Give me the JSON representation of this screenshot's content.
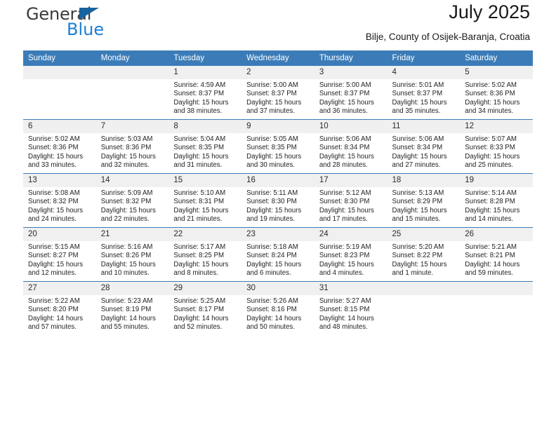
{
  "brand": {
    "name_part1": "General",
    "name_part2": "Blue",
    "triangle_color": "#16639f",
    "blue_color": "#1b7fd4"
  },
  "header": {
    "month_title": "July 2025",
    "location": "Bilje, County of Osijek-Baranja, Croatia"
  },
  "theme": {
    "header_blue": "#3b7cb8",
    "daynum_band": "#f0f0f0",
    "text": "#232323"
  },
  "weekday_headers": [
    "Sunday",
    "Monday",
    "Tuesday",
    "Wednesday",
    "Thursday",
    "Friday",
    "Saturday"
  ],
  "weeks": [
    {
      "days": [
        {
          "num": "",
          "empty": true,
          "sunrise": "",
          "sunset": "",
          "daylight1": "",
          "daylight2": ""
        },
        {
          "num": "",
          "empty": true,
          "sunrise": "",
          "sunset": "",
          "daylight1": "",
          "daylight2": ""
        },
        {
          "num": "1",
          "sunrise": "Sunrise: 4:59 AM",
          "sunset": "Sunset: 8:37 PM",
          "daylight1": "Daylight: 15 hours",
          "daylight2": "and 38 minutes."
        },
        {
          "num": "2",
          "sunrise": "Sunrise: 5:00 AM",
          "sunset": "Sunset: 8:37 PM",
          "daylight1": "Daylight: 15 hours",
          "daylight2": "and 37 minutes."
        },
        {
          "num": "3",
          "sunrise": "Sunrise: 5:00 AM",
          "sunset": "Sunset: 8:37 PM",
          "daylight1": "Daylight: 15 hours",
          "daylight2": "and 36 minutes."
        },
        {
          "num": "4",
          "sunrise": "Sunrise: 5:01 AM",
          "sunset": "Sunset: 8:37 PM",
          "daylight1": "Daylight: 15 hours",
          "daylight2": "and 35 minutes."
        },
        {
          "num": "5",
          "sunrise": "Sunrise: 5:02 AM",
          "sunset": "Sunset: 8:36 PM",
          "daylight1": "Daylight: 15 hours",
          "daylight2": "and 34 minutes."
        }
      ]
    },
    {
      "days": [
        {
          "num": "6",
          "sunrise": "Sunrise: 5:02 AM",
          "sunset": "Sunset: 8:36 PM",
          "daylight1": "Daylight: 15 hours",
          "daylight2": "and 33 minutes."
        },
        {
          "num": "7",
          "sunrise": "Sunrise: 5:03 AM",
          "sunset": "Sunset: 8:36 PM",
          "daylight1": "Daylight: 15 hours",
          "daylight2": "and 32 minutes."
        },
        {
          "num": "8",
          "sunrise": "Sunrise: 5:04 AM",
          "sunset": "Sunset: 8:35 PM",
          "daylight1": "Daylight: 15 hours",
          "daylight2": "and 31 minutes."
        },
        {
          "num": "9",
          "sunrise": "Sunrise: 5:05 AM",
          "sunset": "Sunset: 8:35 PM",
          "daylight1": "Daylight: 15 hours",
          "daylight2": "and 30 minutes."
        },
        {
          "num": "10",
          "sunrise": "Sunrise: 5:06 AM",
          "sunset": "Sunset: 8:34 PM",
          "daylight1": "Daylight: 15 hours",
          "daylight2": "and 28 minutes."
        },
        {
          "num": "11",
          "sunrise": "Sunrise: 5:06 AM",
          "sunset": "Sunset: 8:34 PM",
          "daylight1": "Daylight: 15 hours",
          "daylight2": "and 27 minutes."
        },
        {
          "num": "12",
          "sunrise": "Sunrise: 5:07 AM",
          "sunset": "Sunset: 8:33 PM",
          "daylight1": "Daylight: 15 hours",
          "daylight2": "and 25 minutes."
        }
      ]
    },
    {
      "days": [
        {
          "num": "13",
          "sunrise": "Sunrise: 5:08 AM",
          "sunset": "Sunset: 8:32 PM",
          "daylight1": "Daylight: 15 hours",
          "daylight2": "and 24 minutes."
        },
        {
          "num": "14",
          "sunrise": "Sunrise: 5:09 AM",
          "sunset": "Sunset: 8:32 PM",
          "daylight1": "Daylight: 15 hours",
          "daylight2": "and 22 minutes."
        },
        {
          "num": "15",
          "sunrise": "Sunrise: 5:10 AM",
          "sunset": "Sunset: 8:31 PM",
          "daylight1": "Daylight: 15 hours",
          "daylight2": "and 21 minutes."
        },
        {
          "num": "16",
          "sunrise": "Sunrise: 5:11 AM",
          "sunset": "Sunset: 8:30 PM",
          "daylight1": "Daylight: 15 hours",
          "daylight2": "and 19 minutes."
        },
        {
          "num": "17",
          "sunrise": "Sunrise: 5:12 AM",
          "sunset": "Sunset: 8:30 PM",
          "daylight1": "Daylight: 15 hours",
          "daylight2": "and 17 minutes."
        },
        {
          "num": "18",
          "sunrise": "Sunrise: 5:13 AM",
          "sunset": "Sunset: 8:29 PM",
          "daylight1": "Daylight: 15 hours",
          "daylight2": "and 15 minutes."
        },
        {
          "num": "19",
          "sunrise": "Sunrise: 5:14 AM",
          "sunset": "Sunset: 8:28 PM",
          "daylight1": "Daylight: 15 hours",
          "daylight2": "and 14 minutes."
        }
      ]
    },
    {
      "days": [
        {
          "num": "20",
          "sunrise": "Sunrise: 5:15 AM",
          "sunset": "Sunset: 8:27 PM",
          "daylight1": "Daylight: 15 hours",
          "daylight2": "and 12 minutes."
        },
        {
          "num": "21",
          "sunrise": "Sunrise: 5:16 AM",
          "sunset": "Sunset: 8:26 PM",
          "daylight1": "Daylight: 15 hours",
          "daylight2": "and 10 minutes."
        },
        {
          "num": "22",
          "sunrise": "Sunrise: 5:17 AM",
          "sunset": "Sunset: 8:25 PM",
          "daylight1": "Daylight: 15 hours",
          "daylight2": "and 8 minutes."
        },
        {
          "num": "23",
          "sunrise": "Sunrise: 5:18 AM",
          "sunset": "Sunset: 8:24 PM",
          "daylight1": "Daylight: 15 hours",
          "daylight2": "and 6 minutes."
        },
        {
          "num": "24",
          "sunrise": "Sunrise: 5:19 AM",
          "sunset": "Sunset: 8:23 PM",
          "daylight1": "Daylight: 15 hours",
          "daylight2": "and 4 minutes."
        },
        {
          "num": "25",
          "sunrise": "Sunrise: 5:20 AM",
          "sunset": "Sunset: 8:22 PM",
          "daylight1": "Daylight: 15 hours",
          "daylight2": "and 1 minute."
        },
        {
          "num": "26",
          "sunrise": "Sunrise: 5:21 AM",
          "sunset": "Sunset: 8:21 PM",
          "daylight1": "Daylight: 14 hours",
          "daylight2": "and 59 minutes."
        }
      ]
    },
    {
      "days": [
        {
          "num": "27",
          "sunrise": "Sunrise: 5:22 AM",
          "sunset": "Sunset: 8:20 PM",
          "daylight1": "Daylight: 14 hours",
          "daylight2": "and 57 minutes."
        },
        {
          "num": "28",
          "sunrise": "Sunrise: 5:23 AM",
          "sunset": "Sunset: 8:19 PM",
          "daylight1": "Daylight: 14 hours",
          "daylight2": "and 55 minutes."
        },
        {
          "num": "29",
          "sunrise": "Sunrise: 5:25 AM",
          "sunset": "Sunset: 8:17 PM",
          "daylight1": "Daylight: 14 hours",
          "daylight2": "and 52 minutes."
        },
        {
          "num": "30",
          "sunrise": "Sunrise: 5:26 AM",
          "sunset": "Sunset: 8:16 PM",
          "daylight1": "Daylight: 14 hours",
          "daylight2": "and 50 minutes."
        },
        {
          "num": "31",
          "sunrise": "Sunrise: 5:27 AM",
          "sunset": "Sunset: 8:15 PM",
          "daylight1": "Daylight: 14 hours",
          "daylight2": "and 48 minutes."
        },
        {
          "num": "",
          "empty": true,
          "sunrise": "",
          "sunset": "",
          "daylight1": "",
          "daylight2": ""
        },
        {
          "num": "",
          "empty": true,
          "sunrise": "",
          "sunset": "",
          "daylight1": "",
          "daylight2": ""
        }
      ]
    }
  ]
}
